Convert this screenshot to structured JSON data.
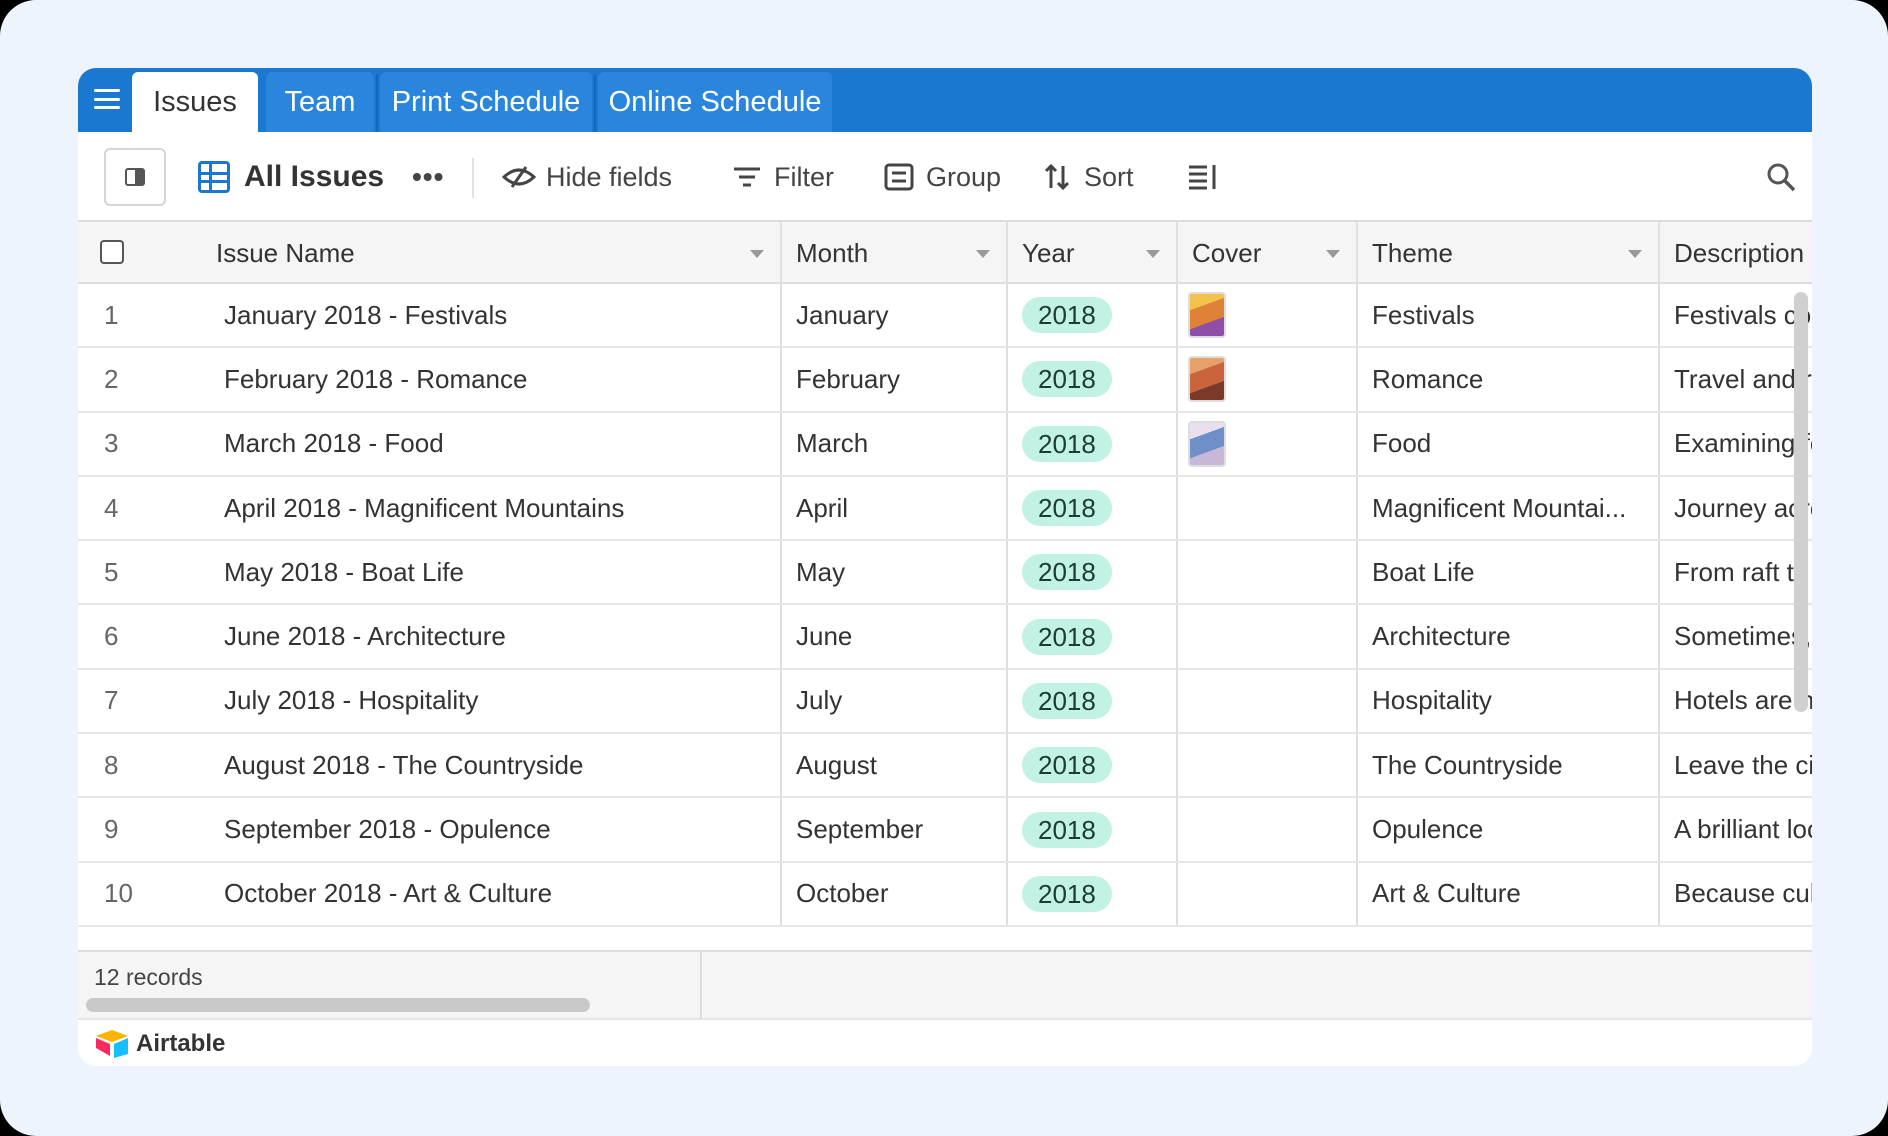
{
  "tabs": [
    {
      "label": "Issues",
      "active": true
    },
    {
      "label": "Team"
    },
    {
      "label": "Print Schedule"
    },
    {
      "label": "Online Schedule"
    }
  ],
  "toolbar": {
    "view_name": "All Issues",
    "more": "•••",
    "hide_fields": "Hide fields",
    "filter": "Filter",
    "group": "Group",
    "sort": "Sort"
  },
  "columns": {
    "name": "Issue Name",
    "month": "Month",
    "year": "Year",
    "cover": "Cover",
    "theme": "Theme",
    "description": "Description"
  },
  "rows": [
    {
      "idx": "1",
      "name": "January 2018 - Festivals",
      "month": "January",
      "year": "2018",
      "cover": true,
      "theme": "Festivals",
      "description": "Festivals come in"
    },
    {
      "idx": "2",
      "name": "February 2018 - Romance",
      "month": "February",
      "year": "2018",
      "cover": true,
      "theme": "Romance",
      "description": "Travel and romanc"
    },
    {
      "idx": "3",
      "name": "March 2018 - Food",
      "month": "March",
      "year": "2018",
      "cover": true,
      "theme": "Food",
      "description": "Examining food in"
    },
    {
      "idx": "4",
      "name": "April 2018 - Magnificent Mountains",
      "month": "April",
      "year": "2018",
      "cover": false,
      "theme": "Magnificent Mountai...",
      "description": "Journey across m"
    },
    {
      "idx": "5",
      "name": "May 2018 - Boat Life",
      "month": "May",
      "year": "2018",
      "cover": false,
      "theme": "Boat Life",
      "description": "From raft to yacht"
    },
    {
      "idx": "6",
      "name": "June 2018 - Architecture",
      "month": "June",
      "year": "2018",
      "cover": false,
      "theme": "Architecture",
      "description": "Sometimes, archit"
    },
    {
      "idx": "7",
      "name": "July 2018 - Hospitality",
      "month": "July",
      "year": "2018",
      "cover": false,
      "theme": "Hospitality",
      "description": "Hotels are not the"
    },
    {
      "idx": "8",
      "name": "August 2018 - The Countryside",
      "month": "August",
      "year": "2018",
      "cover": false,
      "theme": "The Countryside",
      "description": "Leave the city life"
    },
    {
      "idx": "9",
      "name": "September 2018 - Opulence",
      "month": "September",
      "year": "2018",
      "cover": false,
      "theme": "Opulence",
      "description": "A brilliant look at l"
    },
    {
      "idx": "10",
      "name": "October 2018 - Art & Culture",
      "month": "October",
      "year": "2018",
      "cover": false,
      "theme": "Art & Culture",
      "description": "Because culture m"
    }
  ],
  "footer": {
    "records": "12 records",
    "brand": "Airtable"
  },
  "colors": {
    "tabbar": "#1b78d0",
    "year_pill": "#c1f2e4"
  }
}
